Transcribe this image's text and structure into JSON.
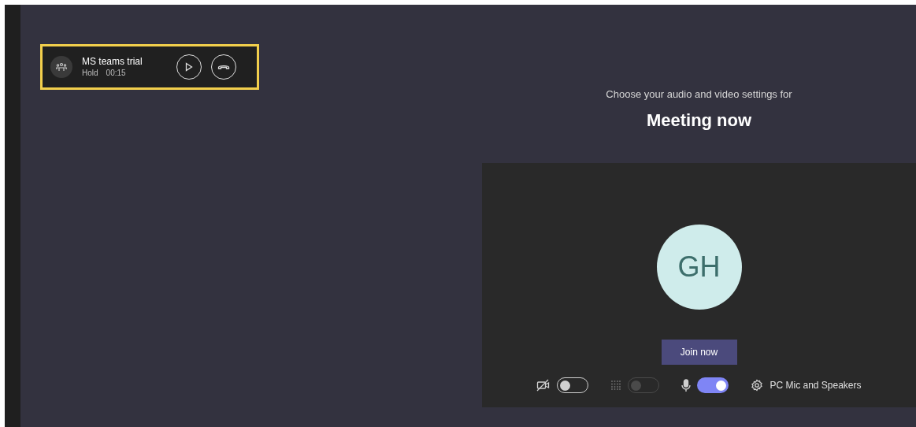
{
  "call_banner": {
    "title": "MS teams trial",
    "status": "Hold",
    "duration": "00:15"
  },
  "prejoin": {
    "subtitle": "Choose your audio and video settings for",
    "title": "Meeting now",
    "avatar_initials": "GH",
    "join_button": "Join now",
    "toggles": [
      {
        "kind": "camera",
        "on": false,
        "disabled": false
      },
      {
        "kind": "blur",
        "on": false,
        "disabled": true
      },
      {
        "kind": "mic",
        "on": true,
        "disabled": false
      }
    ],
    "device_label": "PC Mic and Speakers"
  }
}
